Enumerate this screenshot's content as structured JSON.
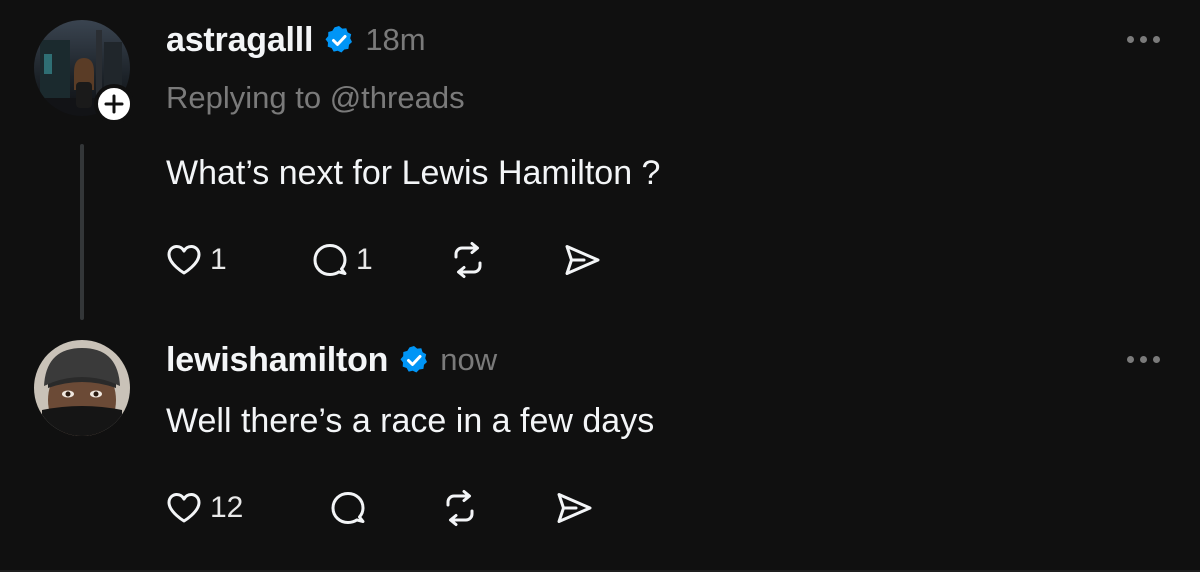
{
  "colors": {
    "background": "#101010",
    "text_primary": "#f3f5f7",
    "text_secondary": "#7a7a7a",
    "verified_blue": "#0095f6",
    "thread_line": "#333638"
  },
  "posts": [
    {
      "username": "astragalll",
      "verified": true,
      "time": "18m",
      "reply_to": "Replying to @threads",
      "text": "What’s next for Lewis Hamilton ?",
      "likes": "1",
      "replies": "1",
      "follow_badge": "+",
      "icons": [
        "heart-icon",
        "comment-icon",
        "repost-icon",
        "send-icon",
        "more-icon"
      ]
    },
    {
      "username": "lewishamilton",
      "verified": true,
      "time": "now",
      "text": "Well there’s a race in a few days",
      "likes": "12",
      "icons": [
        "heart-icon",
        "comment-icon",
        "repost-icon",
        "send-icon",
        "more-icon"
      ]
    }
  ]
}
